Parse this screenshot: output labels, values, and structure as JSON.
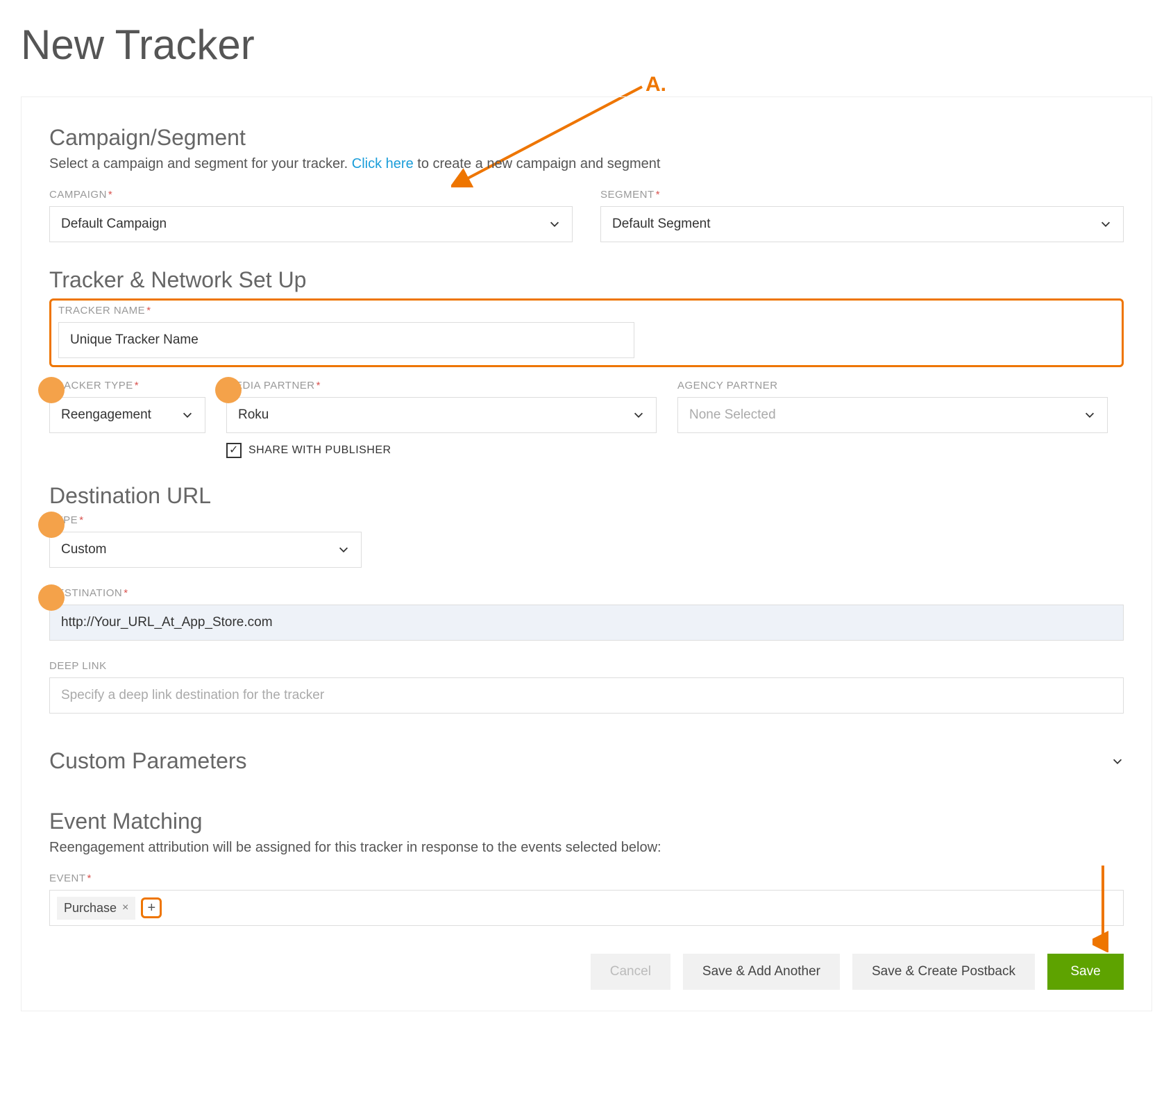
{
  "page_title": "New Tracker",
  "annotation_label": "A.",
  "campaign_segment": {
    "title": "Campaign/Segment",
    "subtext_prefix": "Select a campaign and segment for your tracker. ",
    "link_text": "Click here",
    "subtext_suffix": " to create a new campaign and segment",
    "campaign_label": "CAMPAIGN",
    "campaign_value": "Default Campaign",
    "segment_label": "SEGMENT",
    "segment_value": "Default Segment"
  },
  "tracker_setup": {
    "title": "Tracker & Network Set Up",
    "tracker_name_label": "TRACKER NAME",
    "tracker_name_value": "Unique Tracker Name",
    "tracker_type_label": "TRACKER TYPE",
    "tracker_type_value": "Reengagement",
    "media_partner_label": "MEDIA PARTNER",
    "media_partner_value": "Roku",
    "agency_partner_label": "AGENCY PARTNER",
    "agency_partner_value": "None Selected",
    "share_label": "SHARE WITH PUBLISHER"
  },
  "destination": {
    "title": "Destination URL",
    "type_label": "TYPE",
    "type_value": "Custom",
    "destination_label": "DESTINATION",
    "destination_value": "http://Your_URL_At_App_Store.com",
    "deeplink_label": "DEEP LINK",
    "deeplink_placeholder": "Specify a deep link destination for the tracker"
  },
  "custom_params": {
    "title": "Custom Parameters"
  },
  "event_matching": {
    "title": "Event Matching",
    "subtext": "Reengagement attribution will be assigned for this tracker in response to the events selected below:",
    "event_label": "EVENT",
    "chip_value": "Purchase"
  },
  "buttons": {
    "cancel": "Cancel",
    "save_add": "Save & Add Another",
    "save_postback": "Save & Create Postback",
    "save": "Save"
  },
  "required_mark": "*",
  "checkmark": "✓",
  "plus": "+",
  "x": "×"
}
